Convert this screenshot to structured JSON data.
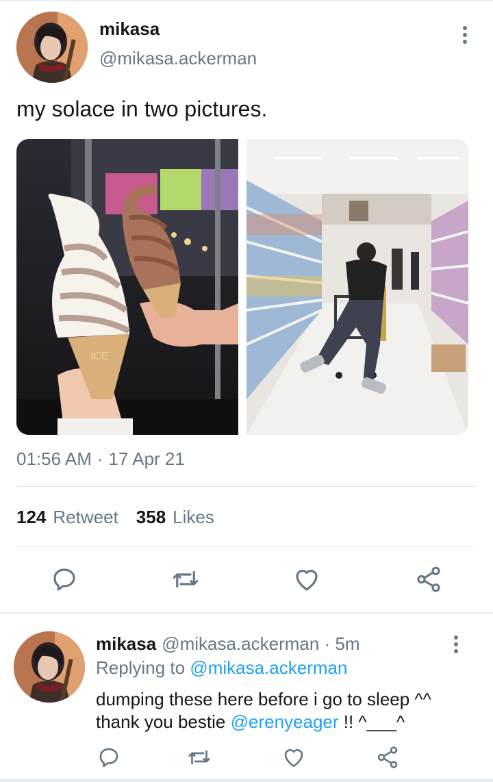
{
  "tweet": {
    "author_name": "mikasa",
    "author_handle": "@mikasa.ackerman",
    "text": "my solace in two pictures.",
    "time": "01:56 AM",
    "separator": "·",
    "date": "17 Apr 21",
    "retweet_count": "124",
    "retweet_label": "Retweet",
    "like_count": "358",
    "like_label": "Likes",
    "photo_text": "ICE",
    "actions": [
      "reply-icon",
      "retweet-icon",
      "like-icon",
      "share-icon"
    ]
  },
  "reply": {
    "author_name": "mikasa",
    "author_handle": "@mikasa.ackerman",
    "separator": "·",
    "time_ago": "5m",
    "replying_label": "Replying to",
    "replying_to": "@mikasa.ackerman",
    "line1": "dumping these here before i go to sleep ^^",
    "line2_prefix": "thank you bestie",
    "mention": "@erenyeager",
    "line2_suffix": "!! ^___^"
  },
  "colors": {
    "text": "#14171a",
    "secondary": "#657786",
    "link": "#1da1f2",
    "divider": "#e1e8ed"
  }
}
